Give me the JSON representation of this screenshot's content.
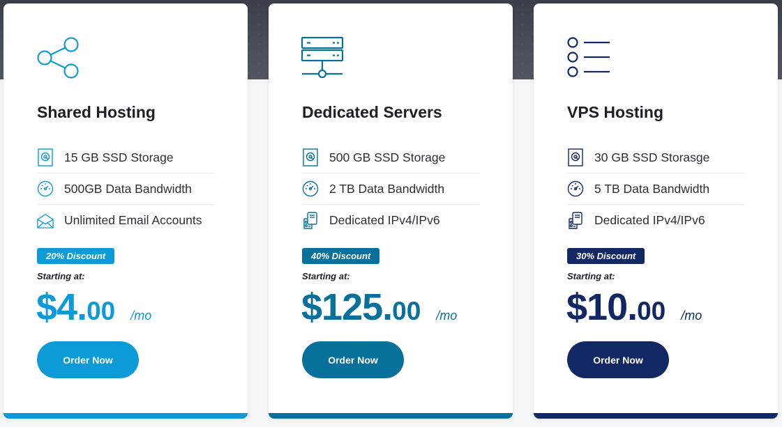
{
  "plans": [
    {
      "title": "Shared Hosting",
      "icon": "share-icon",
      "color": "#0c9bd6",
      "features": [
        {
          "icon": "storage-icon",
          "text": "15 GB SSD Storage"
        },
        {
          "icon": "speedometer-icon",
          "text": "500GB Data Bandwidth"
        },
        {
          "icon": "envelope-icon",
          "text": "Unlimited Email Accounts"
        }
      ],
      "discount": "20% Discount",
      "starting_label": "Starting at:",
      "price_whole": "$4.",
      "price_cents": "00",
      "price_per": "/mo",
      "button_label": "Order Now"
    },
    {
      "title": "Dedicated Servers",
      "icon": "server-icon",
      "color": "#07719b",
      "features": [
        {
          "icon": "storage-icon",
          "text": "500 GB SSD Storage"
        },
        {
          "icon": "speedometer-icon",
          "text": "2 TB Data Bandwidth"
        },
        {
          "icon": "ip-address-icon",
          "text": "Dedicated IPv4/IPv6"
        }
      ],
      "discount": "40% Discount",
      "starting_label": "Starting at:",
      "price_whole": "$125.",
      "price_cents": "00",
      "price_per": "/mo",
      "button_label": "Order Now"
    },
    {
      "title": "VPS Hosting",
      "icon": "list-icon",
      "color": "#112864",
      "features": [
        {
          "icon": "storage-icon",
          "text": "30 GB SSD Storasge"
        },
        {
          "icon": "speedometer-icon",
          "text": "5 TB Data Bandwidth"
        },
        {
          "icon": "ip-address-icon",
          "text": "Dedicated IPv4/IPv6"
        }
      ],
      "discount": "30% Discount",
      "starting_label": "Starting at:",
      "price_whole": "$10.",
      "price_cents": "00",
      "price_per": "/mo",
      "button_label": "Order Now"
    }
  ]
}
